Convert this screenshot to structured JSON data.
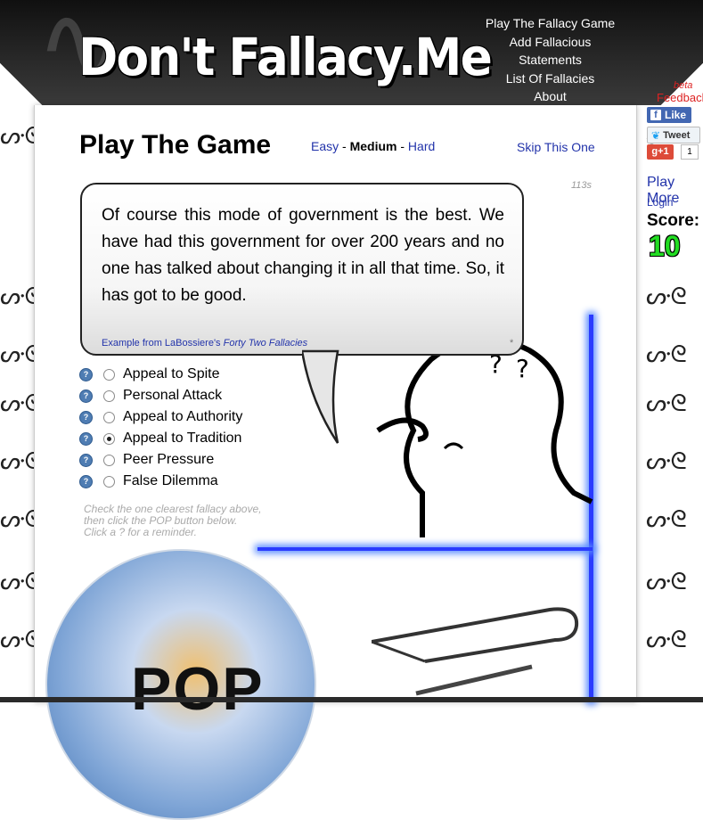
{
  "header": {
    "logo": "Don't Fallacy.Me",
    "nav": [
      "Play The Fallacy Game",
      "Add Fallacious Statements",
      "List Of Fallacies",
      "About"
    ]
  },
  "game": {
    "title": "Play The Game",
    "difficulty": {
      "easy": "Easy",
      "sep1": " - ",
      "medium": "Medium",
      "sep2": " - ",
      "hard": "Hard"
    },
    "skip": "Skip This One",
    "timer": "113s",
    "quote": "Of course this mode of government is the best. We have had this government for over 200 years and no one has talked about changing it in all that time. So, it has got to be good.",
    "source_prefix": "Example from LaBossiere's ",
    "source_title": "Forty Two Fallacies",
    "asterisk": "*",
    "help_glyph": "?",
    "options": [
      {
        "label": "Appeal to Spite",
        "checked": false
      },
      {
        "label": "Personal Attack",
        "checked": false
      },
      {
        "label": "Appeal to Authority",
        "checked": false
      },
      {
        "label": "Appeal to Tradition",
        "checked": true
      },
      {
        "label": "Peer Pressure",
        "checked": false
      },
      {
        "label": "False Dilemma",
        "checked": false
      }
    ],
    "instructions": [
      "Check the one clearest fallacy above,",
      "then click the POP button below.",
      "Click a ? for a reminder."
    ],
    "pop": "POP"
  },
  "sidebar": {
    "beta": "beta",
    "feedback": "Feedback",
    "like": "Like",
    "tweet": "Tweet",
    "gplus": "g+1",
    "gplus_count": "1",
    "play_more": "Play More",
    "login": "Login",
    "score_label": "Score:",
    "score_value": "10"
  },
  "colors": {
    "link": "#2233aa",
    "score": "#22dd22",
    "glow": "#2a3bff",
    "feedback": "#dd2222"
  }
}
